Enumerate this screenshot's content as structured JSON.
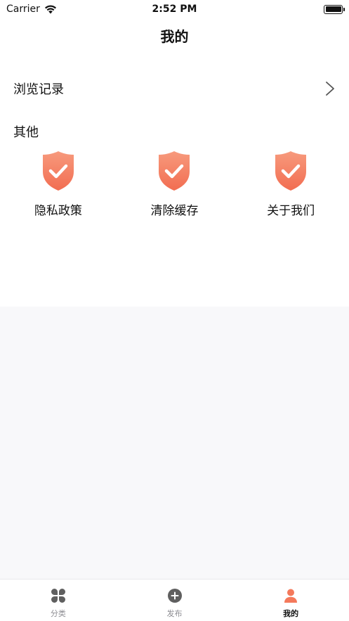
{
  "status_bar": {
    "carrier": "Carrier",
    "time": "2:52 PM"
  },
  "nav": {
    "title": "我的"
  },
  "history": {
    "label": "浏览记录"
  },
  "section": {
    "title": "其他"
  },
  "grid": [
    {
      "label": "隐私政策",
      "icon": "shield-check-icon"
    },
    {
      "label": "清除缓存",
      "icon": "shield-check-icon"
    },
    {
      "label": "关于我们",
      "icon": "shield-check-icon"
    }
  ],
  "tabs": [
    {
      "label": "分类",
      "icon": "four-petal-icon",
      "active": false
    },
    {
      "label": "发布",
      "icon": "plus-circle-icon",
      "active": false
    },
    {
      "label": "我的",
      "icon": "person-icon",
      "active": true
    }
  ],
  "colors": {
    "accent": "#f4795b",
    "shield_top": "#f79a7d",
    "shield_bottom": "#f26d51",
    "tab_inactive": "#5f5f5f",
    "background_gray": "#f8f8fa"
  }
}
